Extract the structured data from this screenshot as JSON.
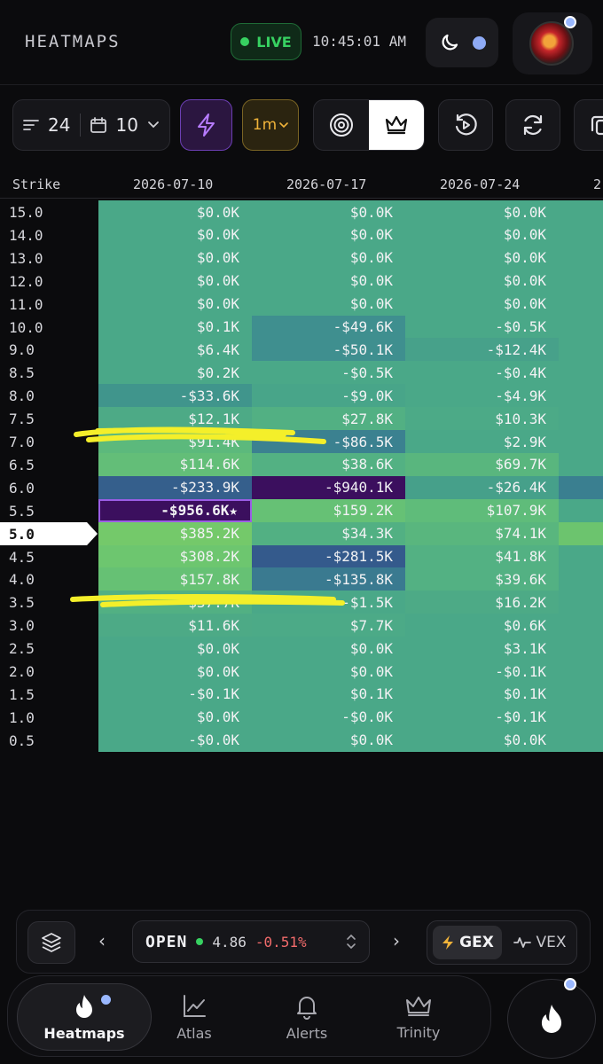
{
  "header": {
    "title": "HEATMAPS",
    "live_label": "LIVE",
    "clock": "10:45:01 AM"
  },
  "toolbar": {
    "strikes_count": "24",
    "expiries_count": "10",
    "interval": "1m"
  },
  "table": {
    "strike_header": "Strike",
    "columns": [
      "2026-07-10",
      "2026-07-17",
      "2026-07-24",
      "2"
    ],
    "current_strike": "5.0",
    "rows": [
      {
        "strike": "15.0",
        "cells": [
          "$0.0K",
          "$0.0K",
          "$0.0K",
          ""
        ],
        "colors": [
          "#4aa888",
          "#4aa888",
          "#4aa888",
          "#4aa888"
        ]
      },
      {
        "strike": "14.0",
        "cells": [
          "$0.0K",
          "$0.0K",
          "$0.0K",
          ""
        ],
        "colors": [
          "#4aa888",
          "#4aa888",
          "#4aa888",
          "#4aa888"
        ]
      },
      {
        "strike": "13.0",
        "cells": [
          "$0.0K",
          "$0.0K",
          "$0.0K",
          ""
        ],
        "colors": [
          "#4aa888",
          "#4aa888",
          "#4aa888",
          "#4aa888"
        ]
      },
      {
        "strike": "12.0",
        "cells": [
          "$0.0K",
          "$0.0K",
          "$0.0K",
          ""
        ],
        "colors": [
          "#4aa888",
          "#4aa888",
          "#4aa888",
          "#4aa888"
        ]
      },
      {
        "strike": "11.0",
        "cells": [
          "$0.0K",
          "$0.0K",
          "$0.0K",
          ""
        ],
        "colors": [
          "#4aa888",
          "#4aa888",
          "#4aa888",
          "#4aa888"
        ]
      },
      {
        "strike": "10.0",
        "cells": [
          "$0.1K",
          "-$49.6K",
          "-$0.5K",
          ""
        ],
        "colors": [
          "#4aa888",
          "#3f8f8f",
          "#4aa888",
          "#4aa888"
        ]
      },
      {
        "strike": "9.0",
        "cells": [
          "$6.4K",
          "-$50.1K",
          "-$12.4K",
          ""
        ],
        "colors": [
          "#4aa888",
          "#3f8f8f",
          "#47a18a",
          "#4aa888"
        ]
      },
      {
        "strike": "8.5",
        "cells": [
          "$0.2K",
          "-$0.5K",
          "-$0.4K",
          ""
        ],
        "colors": [
          "#4aa888",
          "#4aa888",
          "#4aa888",
          "#4aa888"
        ]
      },
      {
        "strike": "8.0",
        "cells": [
          "-$33.6K",
          "-$9.0K",
          "-$4.9K",
          ""
        ],
        "colors": [
          "#40958c",
          "#48a589",
          "#4aa888",
          "#4aa888"
        ]
      },
      {
        "strike": "7.5",
        "cells": [
          "$12.1K",
          "$27.8K",
          "$10.3K",
          ""
        ],
        "colors": [
          "#4daa86",
          "#52b083",
          "#4caa87",
          "#4aa888"
        ]
      },
      {
        "strike": "7.0",
        "cells": [
          "$91.4K",
          "-$86.5K",
          "$2.9K",
          ""
        ],
        "colors": [
          "#5cb97c",
          "#3b8190",
          "#4aa888",
          "#4aa888"
        ]
      },
      {
        "strike": "6.5",
        "cells": [
          "$114.6K",
          "$38.6K",
          "$69.7K",
          ""
        ],
        "colors": [
          "#63be78",
          "#53b183",
          "#59b67e",
          "#4aa888"
        ]
      },
      {
        "strike": "6.0",
        "cells": [
          "-$233.9K",
          "-$940.1K",
          "-$26.4K",
          ""
        ],
        "colors": [
          "#355f8c",
          "#3b0f5e",
          "#46a08a",
          "#3a7f90"
        ]
      },
      {
        "strike": "5.5",
        "cells": [
          "-$956.6K★",
          "$159.2K",
          "$107.9K",
          ""
        ],
        "colors": [
          "#3b0f5e",
          "#66c175",
          "#5fbc7a",
          "#4aa888"
        ]
      },
      {
        "strike": "5.0",
        "cells": [
          "$385.2K",
          "$34.3K",
          "$74.1K",
          ""
        ],
        "colors": [
          "#74c96a",
          "#52b083",
          "#59b67e",
          "#6cc46e"
        ]
      },
      {
        "strike": "4.5",
        "cells": [
          "$308.2K",
          "-$281.5K",
          "$41.8K",
          ""
        ],
        "colors": [
          "#6dc66f",
          "#345a8c",
          "#53b183",
          "#4aa888"
        ]
      },
      {
        "strike": "4.0",
        "cells": [
          "$157.8K",
          "-$135.8K",
          "$39.6K",
          ""
        ],
        "colors": [
          "#66c174",
          "#3a7a90",
          "#53b183",
          "#4aa888"
        ]
      },
      {
        "strike": "3.5",
        "cells": [
          "$37.7K",
          "-$1.5K",
          "$16.2K",
          ""
        ],
        "colors": [
          "#52b083",
          "#4aa888",
          "#4daa86",
          "#4aa888"
        ]
      },
      {
        "strike": "3.0",
        "cells": [
          "$11.6K",
          "$7.7K",
          "$0.6K",
          ""
        ],
        "colors": [
          "#4daa86",
          "#4caa87",
          "#4aa888",
          "#4aa888"
        ]
      },
      {
        "strike": "2.5",
        "cells": [
          "$0.0K",
          "$0.0K",
          "$3.1K",
          ""
        ],
        "colors": [
          "#4aa888",
          "#4aa888",
          "#4aa888",
          "#4aa888"
        ]
      },
      {
        "strike": "2.0",
        "cells": [
          "$0.0K",
          "$0.0K",
          "-$0.1K",
          ""
        ],
        "colors": [
          "#4aa888",
          "#4aa888",
          "#4aa888",
          "#4aa888"
        ]
      },
      {
        "strike": "1.5",
        "cells": [
          "-$0.1K",
          "$0.1K",
          "$0.1K",
          ""
        ],
        "colors": [
          "#4aa888",
          "#4aa888",
          "#4aa888",
          "#4aa888"
        ]
      },
      {
        "strike": "1.0",
        "cells": [
          "$0.0K",
          "-$0.0K",
          "-$0.1K",
          ""
        ],
        "colors": [
          "#4aa888",
          "#4aa888",
          "#4aa888",
          "#4aa888"
        ]
      },
      {
        "strike": "0.5",
        "cells": [
          "-$0.0K",
          "$0.0K",
          "$0.0K",
          ""
        ],
        "colors": [
          "#4aa888",
          "#4aa888",
          "#4aa888",
          "#4aa888"
        ]
      }
    ]
  },
  "controls": {
    "ticker": "OPEN",
    "price": "4.86",
    "change": "-0.51%",
    "mode_gex": "GEX",
    "mode_vex": "VEX"
  },
  "nav": {
    "items": [
      {
        "label": "Heatmaps",
        "icon": "flame-icon"
      },
      {
        "label": "Atlas",
        "icon": "chart-icon"
      },
      {
        "label": "Alerts",
        "icon": "bell-icon"
      },
      {
        "label": "Trinity",
        "icon": "crown-icon"
      }
    ]
  },
  "colors": {
    "accent_purple": "#6c3fb4",
    "live_green": "#37d161",
    "negative_red": "#f26b6b"
  }
}
